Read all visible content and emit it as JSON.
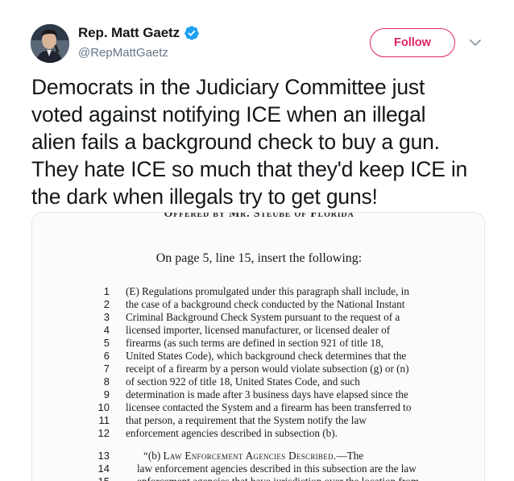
{
  "tweet": {
    "display_name": "Rep. Matt Gaetz",
    "handle": "@RepMattGaetz",
    "follow_label": "Follow",
    "text": "Democrats in the Judiciary Committee just\nvoted against notifying ICE when an illegal\nalien fails a background check to buy a gun.\nThey hate ICE so much that they'd keep ICE in\nthe dark when illegals try to get guns!"
  },
  "icons": {
    "verified": "verified-badge-icon",
    "caret": "chevron-down-icon"
  },
  "colors": {
    "follow_accent": "#e0245e",
    "verified_blue": "#1da1f2",
    "handle_gray": "#657786"
  },
  "document": {
    "header": "Offered by Mr. Steube of Florida",
    "instruction": "On page 5, line 15, insert the following:",
    "lines": [
      {
        "num": "1",
        "text": "(E) Regulations promulgated under this paragraph shall include, in"
      },
      {
        "num": "2",
        "text": "the case of a background check conducted by the National Instant"
      },
      {
        "num": "3",
        "text": "Criminal Background Check System pursuant to the request of a"
      },
      {
        "num": "4",
        "text": "licensed importer, licensed manufacturer, or licensed dealer of"
      },
      {
        "num": "5",
        "text": "firearms (as such terms are defined in section 921 of title 18,"
      },
      {
        "num": "6",
        "text": "United States Code), which background check determines that the"
      },
      {
        "num": "7",
        "text": "receipt of a firearm by a person would violate subsection (g) or (n)"
      },
      {
        "num": "8",
        "text": "of section 922 of title 18, United States Code, and such"
      },
      {
        "num": "9",
        "text": "determination is made after 3 business days have elapsed since the"
      },
      {
        "num": "10",
        "text": "licensee contacted the System and a firearm has been transferred to"
      },
      {
        "num": "11",
        "text": "that person, a requirement that the System notify the law"
      },
      {
        "num": "12",
        "text": "enforcement agencies described in subsection (b)."
      },
      {
        "num": "13",
        "text_prefix": "“(b) ",
        "text_sc": "Law Enforcement Agencies Described.",
        "text_suffix": "—The"
      },
      {
        "num": "14",
        "text": "law enforcement agencies described in this subsection are the law"
      },
      {
        "num": "15",
        "text": "enforcement agencies that have jurisdiction over the location from"
      }
    ]
  }
}
